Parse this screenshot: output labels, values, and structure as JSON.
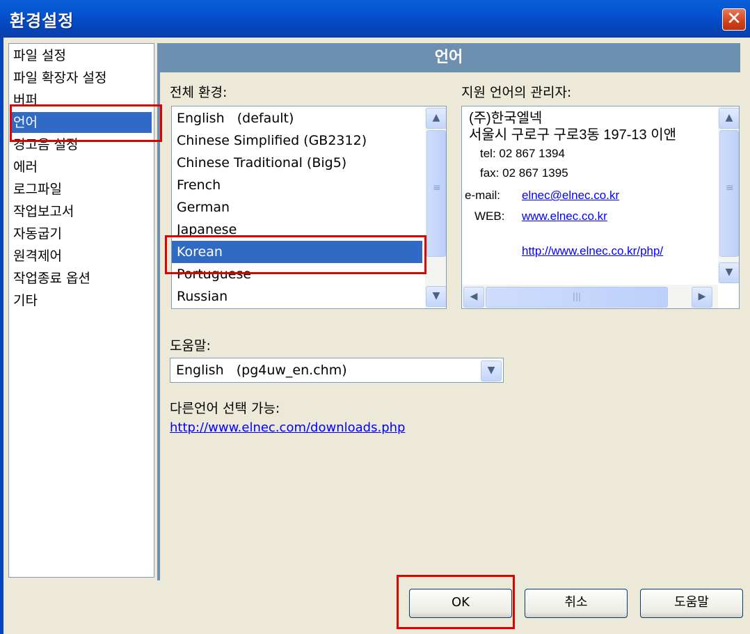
{
  "window": {
    "title": "환경설정",
    "close_glyph": "✕"
  },
  "nav": {
    "items": [
      {
        "label": "파일 설정",
        "selected": false
      },
      {
        "label": "파일 확장자 설정",
        "selected": false
      },
      {
        "label": "버퍼",
        "selected": false
      },
      {
        "label": "언어",
        "selected": true
      },
      {
        "label": "경고음 설정",
        "selected": false
      },
      {
        "label": "에러",
        "selected": false
      },
      {
        "label": "로그파일",
        "selected": false
      },
      {
        "label": "작업보고서",
        "selected": false
      },
      {
        "label": "자동굽기",
        "selected": false
      },
      {
        "label": "원격제어",
        "selected": false
      },
      {
        "label": "작업종료 옵션",
        "selected": false
      },
      {
        "label": "기타",
        "selected": false
      }
    ]
  },
  "panel": {
    "header": "언어",
    "env_label": "전체 환경:",
    "support_label": "지원 언어의 관리자:",
    "languages": [
      "English   (default)",
      "Chinese Simplified (GB2312)",
      "Chinese Traditional (Big5)",
      "French",
      "German",
      "Japanese",
      "Korean",
      "Portuguese",
      "Russian"
    ],
    "selected_language": "Korean",
    "contact": {
      "company": "(주)한국엘넥",
      "address": "서울시 구로구 구로3동 197-13 이앤",
      "tel": "tel:  02 867 1394",
      "fax": "fax: 02 867 1395",
      "email_label": "e-mail:",
      "email": "elnec@elnec.co.kr",
      "web_label": "WEB:",
      "web": "www.elnec.co.kr",
      "web_url": "http://www.elnec.co.kr/php/"
    },
    "help_label": "도움말:",
    "help_value": "English   (pg4uw_en.chm)",
    "other_lang_label": "다른언어 선택 가능:",
    "download_link": "http://www.elnec.com/downloads.php"
  },
  "buttons": {
    "ok": "OK",
    "cancel": "취소",
    "help": "도움말"
  },
  "icons": {
    "scroll_up": "▲",
    "scroll_down": "▼",
    "scroll_left": "◀",
    "scroll_right": "▶",
    "dropdown": "▼",
    "grip": "≡",
    "grip_h": "|||"
  },
  "colors": {
    "selection": "#316ac5",
    "header": "#6d8fb0",
    "highlight_box": "#e00000",
    "link": "#0000ff"
  }
}
